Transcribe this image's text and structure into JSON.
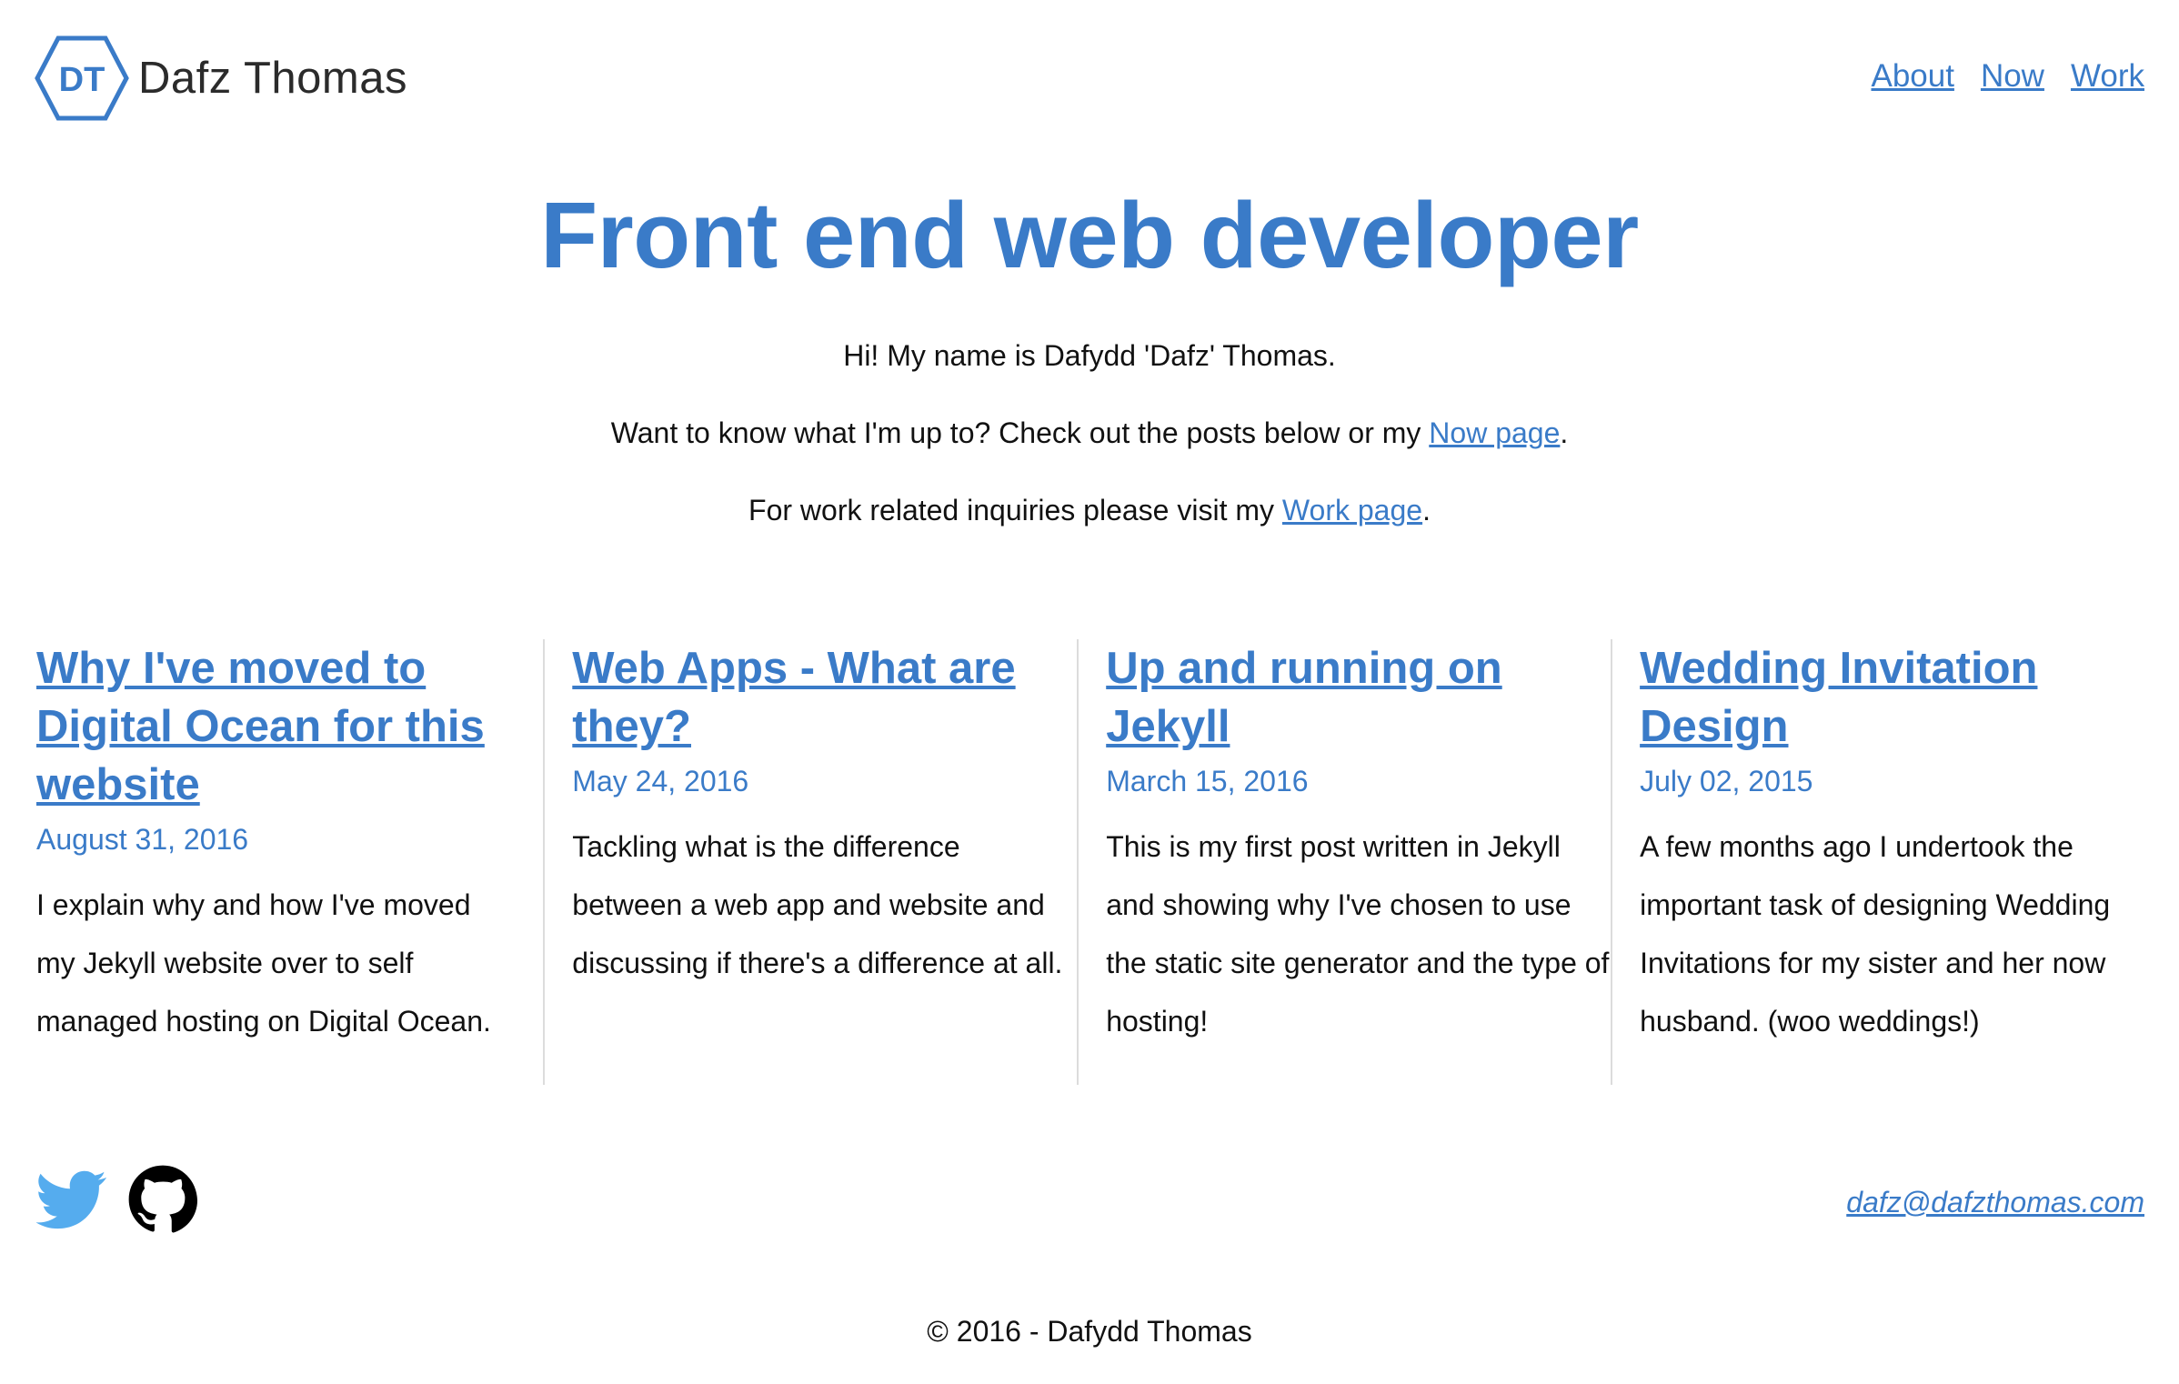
{
  "header": {
    "logo_initials": "DT",
    "brand_name": "Dafz Thomas",
    "nav": [
      {
        "label": "About"
      },
      {
        "label": "Now"
      },
      {
        "label": "Work"
      }
    ]
  },
  "hero": {
    "title": "Front end web developer",
    "line1": "Hi! My name is Dafydd 'Dafz' Thomas.",
    "line2_text": "Want to know what I'm up to? Check out the posts below or my ",
    "line2_link": "Now page",
    "line2_end": ".",
    "line3_text": "For work related inquiries please visit my ",
    "line3_link": "Work page",
    "line3_end": "."
  },
  "posts": [
    {
      "title": "Why I've moved to Digital Ocean for this website",
      "date": "August 31, 2016",
      "excerpt": "I explain why and how I've moved my Jekyll website over to self managed hosting on Digital Ocean."
    },
    {
      "title": "Web Apps - What are they?",
      "date": "May 24, 2016",
      "excerpt": "Tackling what is the difference between a web app and website and discussing if there's a difference at all."
    },
    {
      "title": "Up and running on Jekyll",
      "date": "March 15, 2016",
      "excerpt": "This is my first post written in Jekyll and showing why I've chosen to use the static site generator and the type of hosting!"
    },
    {
      "title": "Wedding Invitation Design",
      "date": "July 02, 2015",
      "excerpt": "A few months ago I undertook the important task of designing Wedding Invitations for my sister and her now husband. (woo weddings!)"
    }
  ],
  "footer": {
    "social": [
      {
        "icon": "twitter-icon",
        "color": "#55acee"
      },
      {
        "icon": "github-icon",
        "color": "#000000"
      }
    ],
    "email": "dafz@dafzthomas.com",
    "copyright": "© 2016 - Dafydd Thomas"
  },
  "colors": {
    "accent": "#3a7bc8",
    "text": "#111111",
    "divider": "#dcdcdc"
  }
}
